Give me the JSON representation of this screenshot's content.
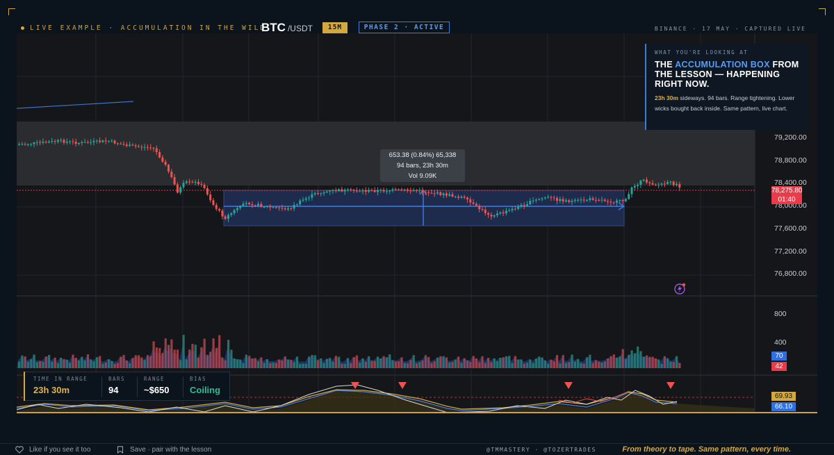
{
  "header": {
    "live_label": "LIVE EXAMPLE · ACCUMULATION IN THE WILD",
    "symbol": "BTC",
    "quote": "/USDT",
    "timeframe": "15M",
    "phase": "PHASE 2 · ACTIVE",
    "source": "BINANCE · 17 MAY · CAPTURED LIVE"
  },
  "info_card": {
    "kicker": "WHAT YOU'RE LOOKING AT",
    "title_pre": "THE ",
    "title_highlight": "ACCUMULATION BOX",
    "title_post": " FROM THE LESSON — HAPPENING RIGHT NOW.",
    "duration": "23h 30m",
    "body": " sideways. 94 bars. Range tightening. Lower wicks bought back inside. Same pattern, live chart."
  },
  "measure_tooltip": {
    "line1": "653.38 (0.84%) 65,338",
    "line2": "94 bars, 23h 30m",
    "line3": "Vol 9.09K"
  },
  "price_axis": {
    "labels": [
      "79,200.00",
      "78,800.00",
      "78,400.00",
      "78,000.00",
      "77,600.00",
      "77,200.00",
      "76,800.00"
    ],
    "last_price": "78,275.80",
    "countdown": "01:40"
  },
  "volume_axis": {
    "labels": [
      "800",
      "400"
    ],
    "tag_blue": "70",
    "tag_red": "42"
  },
  "oscillator": {
    "value_gold": "69.93",
    "value_blue": "66.10"
  },
  "stats": {
    "time_label": "TIME IN RANGE",
    "time_value": "23h 30m",
    "bars_label": "BARS",
    "bars_value": "94",
    "range_label": "RANGE",
    "range_value": "~$650",
    "bias_label": "BIAS",
    "bias_value": "Coiling"
  },
  "footer": {
    "like": "Like if you see it too",
    "save": "Save · pair with the lesson",
    "handles": "@TMMASTERY · @TOZERTRADES",
    "tagline": "From theory to tape. Same pattern, every time."
  },
  "colors": {
    "gold": "#d4a840",
    "blue": "#3b7dd8",
    "up": "#26a69a",
    "down": "#ef5350",
    "price_tag": "#e83c4a"
  },
  "icons": {
    "like": "heart-icon",
    "save": "bookmark-icon",
    "alert": "lightning-icon"
  }
}
